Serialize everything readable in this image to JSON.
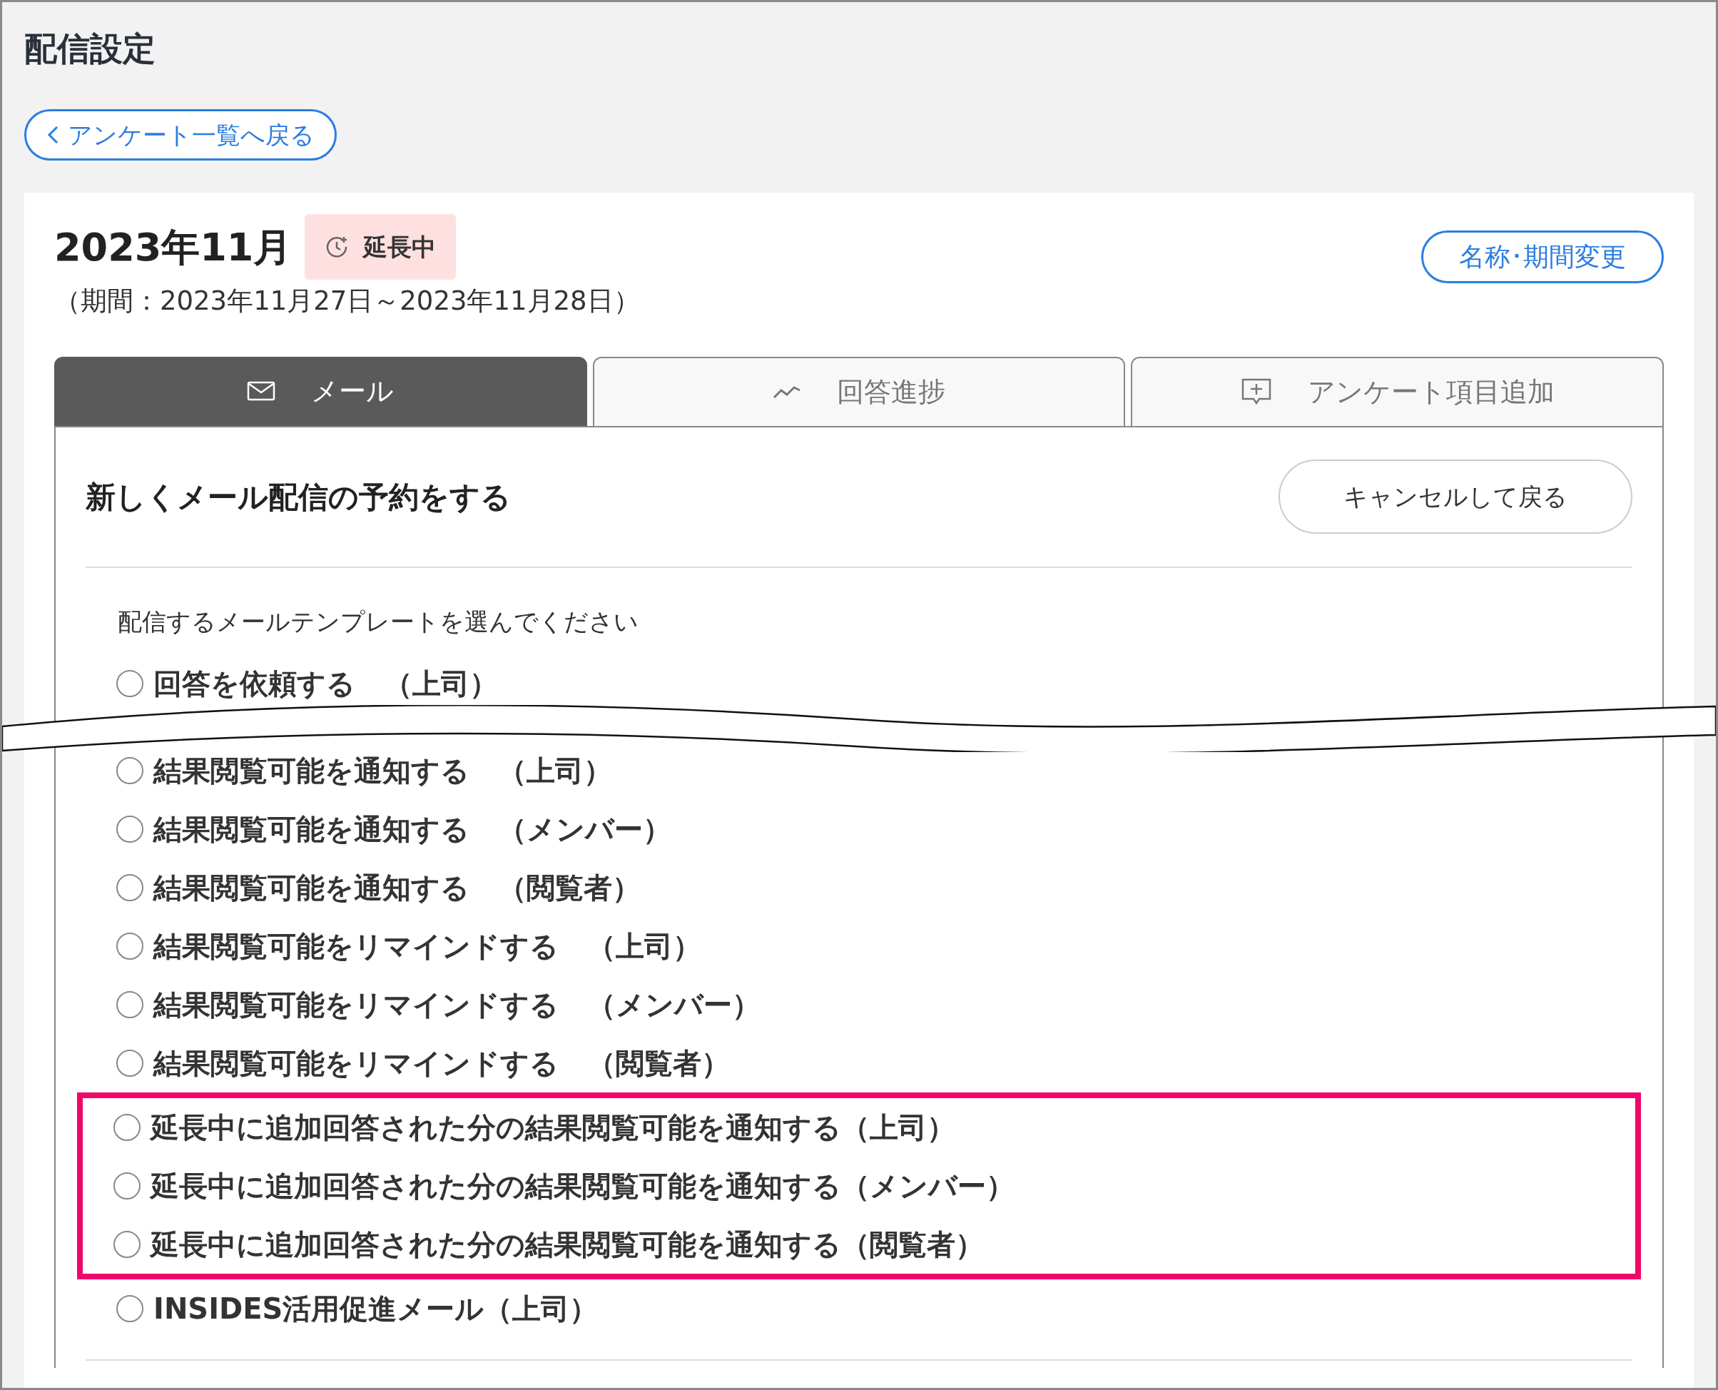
{
  "page_title": "配信設定",
  "back_button": {
    "label": "アンケート一覧へ戻る"
  },
  "survey": {
    "name": "2023年11月",
    "status_badge": "延長中",
    "period": "（期間：2023年11月27日～2023年11月28日）",
    "rename_button": "名称･期間変更"
  },
  "tabs": [
    {
      "label": "メール",
      "selected": true
    },
    {
      "label": "回答進捗",
      "selected": false
    },
    {
      "label": "アンケート項目追加",
      "selected": false
    }
  ],
  "mail_panel": {
    "heading": "新しくメール配信の予約をする",
    "cancel_button": "キャンセルして戻る",
    "prompt": "配信するメールテンプレートを選んでください",
    "templates": [
      {
        "label": "回答を依頼する　（上司）",
        "selected": false,
        "highlighted": false
      },
      {
        "label": "結果閲覧可能を通知する　（上司）",
        "selected": false,
        "highlighted": false
      },
      {
        "label": "結果閲覧可能を通知する　（メンバー）",
        "selected": false,
        "highlighted": false
      },
      {
        "label": "結果閲覧可能を通知する　（閲覧者）",
        "selected": false,
        "highlighted": false
      },
      {
        "label": "結果閲覧可能をリマインドする　（上司）",
        "selected": false,
        "highlighted": false
      },
      {
        "label": "結果閲覧可能をリマインドする　（メンバー）",
        "selected": false,
        "highlighted": false
      },
      {
        "label": "結果閲覧可能をリマインドする　（閲覧者）",
        "selected": false,
        "highlighted": false
      },
      {
        "label": "延長中に追加回答された分の結果閲覧可能を通知する（上司）",
        "selected": false,
        "highlighted": true
      },
      {
        "label": "延長中に追加回答された分の結果閲覧可能を通知する（メンバー）",
        "selected": false,
        "highlighted": true
      },
      {
        "label": "延長中に追加回答された分の結果閲覧可能を通知する（閲覧者）",
        "selected": false,
        "highlighted": true
      },
      {
        "label": "INSIDES活用促進メール（上司）",
        "selected": false,
        "highlighted": false
      }
    ]
  }
}
